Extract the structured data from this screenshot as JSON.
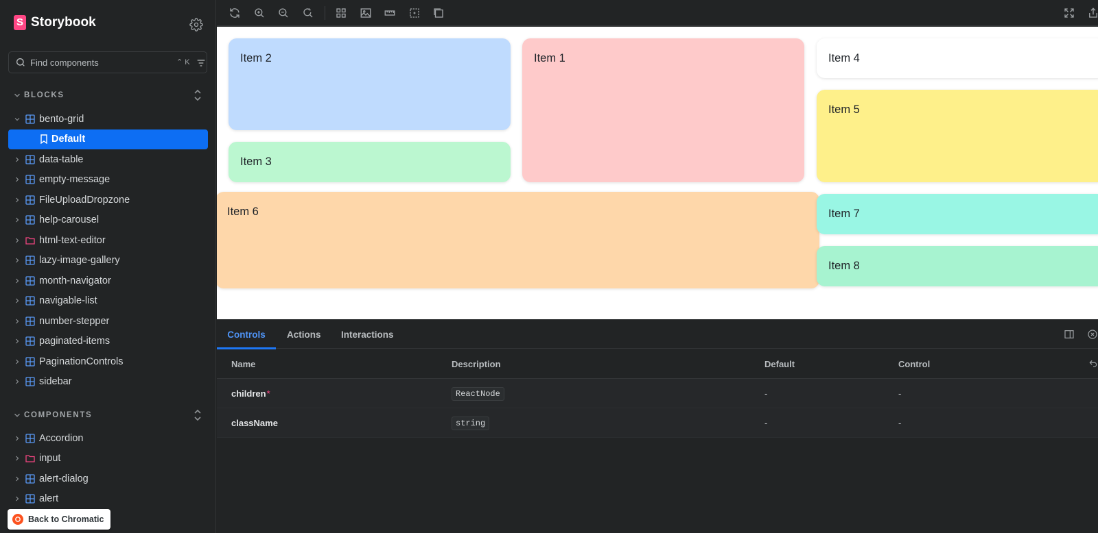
{
  "app": {
    "name": "Storybook",
    "logo_letter": "S"
  },
  "search": {
    "placeholder": "Find components",
    "shortcut": "⌃ K"
  },
  "sections": {
    "blocks": {
      "label": "BLOCKS",
      "items": [
        {
          "label": "bento-grid",
          "icon": "component-icon",
          "expanded": true
        },
        {
          "label": "Default",
          "icon": "story-bookmark-icon",
          "selected": true
        },
        {
          "label": "data-table",
          "icon": "component-icon"
        },
        {
          "label": "empty-message",
          "icon": "component-icon"
        },
        {
          "label": "FileUploadDropzone",
          "icon": "component-icon"
        },
        {
          "label": "help-carousel",
          "icon": "component-icon"
        },
        {
          "label": "html-text-editor",
          "icon": "folder-icon"
        },
        {
          "label": "lazy-image-gallery",
          "icon": "component-icon"
        },
        {
          "label": "month-navigator",
          "icon": "component-icon"
        },
        {
          "label": "navigable-list",
          "icon": "component-icon"
        },
        {
          "label": "number-stepper",
          "icon": "component-icon"
        },
        {
          "label": "paginated-items",
          "icon": "component-icon"
        },
        {
          "label": "PaginationControls",
          "icon": "component-icon"
        },
        {
          "label": "sidebar",
          "icon": "component-icon"
        }
      ]
    },
    "components": {
      "label": "COMPONENTS",
      "items": [
        {
          "label": "Accordion",
          "icon": "component-icon"
        },
        {
          "label": "input",
          "icon": "folder-icon"
        },
        {
          "label": "alert-dialog",
          "icon": "component-icon"
        },
        {
          "label": "alert",
          "icon": "component-icon"
        }
      ]
    }
  },
  "back_button": {
    "label": "Back to Chromatic"
  },
  "canvas": {
    "items": [
      {
        "label": "Item 2",
        "color": "#bfdbfe"
      },
      {
        "label": "Item 1",
        "color": "#fecaca"
      },
      {
        "label": "Item 4",
        "color": "#ffffff"
      },
      {
        "label": "Item 3",
        "color": "#bbf7d0"
      },
      {
        "label": "Item 5",
        "color": "#fef08a"
      },
      {
        "label": "Item 6",
        "color": "#fed7aa"
      },
      {
        "label": "Item 7",
        "color": "#99f6e4"
      },
      {
        "label": "Item 8",
        "color": "#a7f3d0"
      }
    ]
  },
  "panel": {
    "tabs": [
      "Controls",
      "Actions",
      "Interactions"
    ],
    "active_tab": "Controls",
    "columns": [
      "Name",
      "Description",
      "Default",
      "Control"
    ],
    "rows": [
      {
        "name": "children",
        "required": true,
        "required_mark": "*",
        "type": "ReactNode",
        "default": "-",
        "control": "-"
      },
      {
        "name": "className",
        "required": false,
        "required_mark": "",
        "type": "string",
        "default": "-",
        "control": "-"
      }
    ]
  },
  "colors": {
    "accent": "#1e77f5",
    "selected_bg": "#0d6ef3",
    "brand": "#ff4785",
    "sidebar_bg": "#222425",
    "canvas_bg": "#ffffff"
  }
}
